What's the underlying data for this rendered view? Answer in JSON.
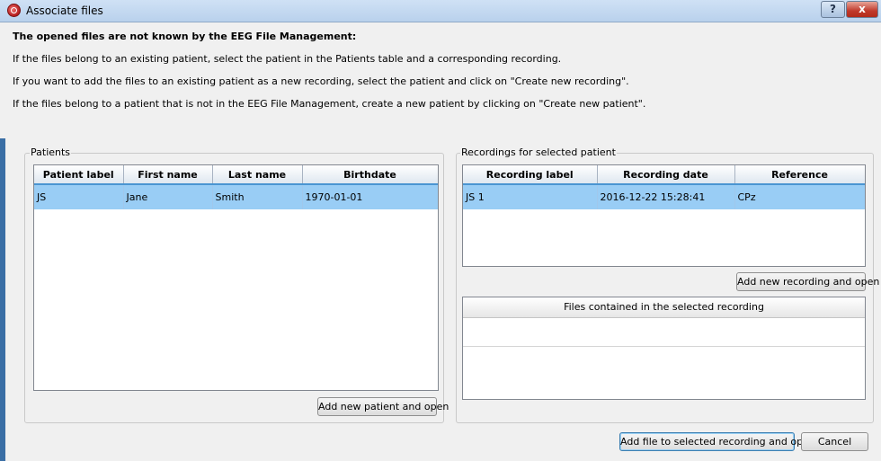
{
  "window": {
    "title": "Associate files",
    "help_label": "?",
    "close_label": "x"
  },
  "intro": {
    "heading": "The opened files are not known by the EEG File Management:",
    "line1": "If the files belong to an existing patient, select the patient in the Patients table and a corresponding recording.",
    "line2": "If you want to add the files to an existing patient as a new recording, select the patient and click on \"Create new recording\".",
    "line3": "If the files belong to a patient that is not in the EEG File Management, create a new patient by clicking on \"Create new patient\"."
  },
  "patients": {
    "group_label": "Patients",
    "columns": [
      "Patient label",
      "First name",
      "Last name",
      "Birthdate"
    ],
    "rows": [
      [
        "JS",
        "Jane",
        "Smith",
        "1970-01-01"
      ]
    ],
    "selected_row": 0,
    "add_button": "Add new patient and open"
  },
  "recordings": {
    "group_label": "Recordings for selected patient",
    "columns": [
      "Recording label",
      "Recording date",
      "Reference"
    ],
    "rows": [
      [
        "JS 1",
        "2016-12-22 15:28:41",
        "CPz"
      ]
    ],
    "selected_row": 0,
    "add_button": "Add new recording and open"
  },
  "files": {
    "header": "Files contained in the selected recording"
  },
  "footer": {
    "add_file_button": "Add file to selected recording and open",
    "cancel_button": "Cancel"
  },
  "colors": {
    "selection": "#99cdf5",
    "header_underline": "#4a95d2",
    "close_button": "#c0392b"
  }
}
